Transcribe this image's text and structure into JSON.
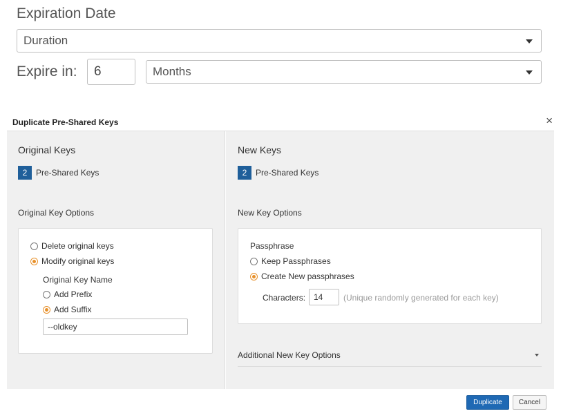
{
  "expiration": {
    "title": "Expiration Date",
    "type_select": "Duration",
    "expire_label": "Expire in:",
    "expire_value": "6",
    "unit_select": "Months"
  },
  "modal": {
    "title": "Duplicate Pre-Shared Keys",
    "close_glyph": "×",
    "original": {
      "heading": "Original Keys",
      "count": "2",
      "count_label": "Pre-Shared Keys",
      "options_heading": "Original Key Options",
      "delete_label": "Delete original keys",
      "modify_label": "Modify original keys",
      "name_heading": "Original Key Name",
      "prefix_label": "Add Prefix",
      "suffix_label": "Add Suffix",
      "suffix_value": "--oldkey"
    },
    "new": {
      "heading": "New Keys",
      "count": "2",
      "count_label": "Pre-Shared Keys",
      "options_heading": "New Key Options",
      "passphrase_heading": "Passphrase",
      "keep_label": "Keep Passphrases",
      "create_label": "Create New passphrases",
      "characters_label": "Characters:",
      "characters_value": "14",
      "characters_hint": "(Unique randomly generated for each key)",
      "additional_label": "Additional New Key Options"
    },
    "buttons": {
      "duplicate": "Duplicate",
      "cancel": "Cancel"
    },
    "colors": {
      "accent_blue": "#1f69b4",
      "badge_blue": "#1f5f9a",
      "radio_orange": "#e8912b"
    }
  }
}
